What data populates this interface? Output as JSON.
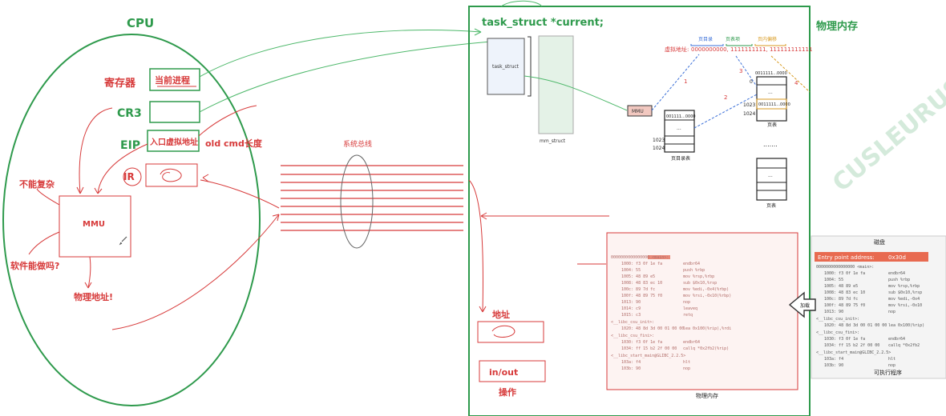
{
  "cpu": {
    "title": "CPU",
    "register_label": "寄存器",
    "register_value": "当前进程",
    "cr3_label": "CR3",
    "eip_label": "EIP",
    "eip_value": "入口虚拟地址",
    "eip_note": "old cmd长度",
    "ir_label": "IR",
    "mmu_label": "MMU",
    "note_not_complex": "不能复杂",
    "note_software": "软件能做吗?",
    "note_physical_address": "物理地址!"
  },
  "bus": {
    "label": "系统总线"
  },
  "memory": {
    "title": "物理内存",
    "task_struct_title": "task_struct *current;",
    "task_struct_box": "task_struct",
    "mm_struct_box": "mm_struct",
    "mmu_small": "MMU",
    "virtual_address_label": "虚拟地址:",
    "virtual_address_value": "0000000000, 1111111111, 111111111111",
    "va_headers": [
      "页目录",
      "页表项",
      "页内偏移"
    ],
    "page_directory": {
      "top": "001111...0000",
      "middle": "...",
      "rows": [
        "1023",
        "1024"
      ],
      "label": "页目录表"
    },
    "page_table_1": {
      "top": "0011111...0000",
      "rows": [
        "0",
        "1023",
        "1024"
      ],
      "middle": "...",
      "label": "页表"
    },
    "page_table_2": {
      "middle": "...",
      "label": "页表"
    },
    "ellipsis": ".......",
    "arrow_numbers": [
      "1",
      "2",
      "3",
      "4"
    ],
    "address_label": "地址",
    "inout_label": "in/out",
    "operation_label": "操作",
    "panel_label": "物理内存"
  },
  "disk": {
    "title": "磁盘",
    "entry_label": "Entry point address:",
    "entry_value": "0x30d",
    "load_label": "加载",
    "panel_label": "可执行程序"
  },
  "watermark": "CUSLEURUS"
}
